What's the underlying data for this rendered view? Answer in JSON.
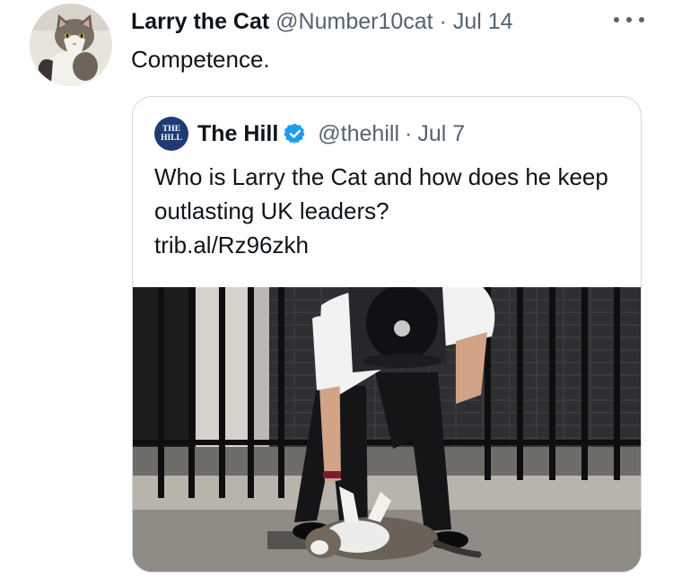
{
  "tweet": {
    "author_name": "Larry the Cat",
    "author_handle": "@Number10cat",
    "separator": "·",
    "date": "Jul 14",
    "text": "Competence.",
    "avatar_icon": "cat-avatar-icon",
    "more_icon": "more-options-icon"
  },
  "quoted_tweet": {
    "author_name": "The Hill",
    "author_handle": "@thehill",
    "separator": "·",
    "date": "Jul 7",
    "avatar_text": [
      "THE",
      "HILL"
    ],
    "verified_icon": "verified-badge-icon",
    "text": "Who is Larry the Cat and how does he keep outlasting UK leaders?",
    "link": "trib.al/Rz96zkh",
    "media_icon": "police-officer-petting-cat-photo"
  },
  "colors": {
    "text_primary": "#0f1419",
    "text_secondary": "#536471",
    "border": "#cfd9de",
    "verified_blue": "#1d9bf0",
    "hill_blue": "#1e3b73"
  }
}
